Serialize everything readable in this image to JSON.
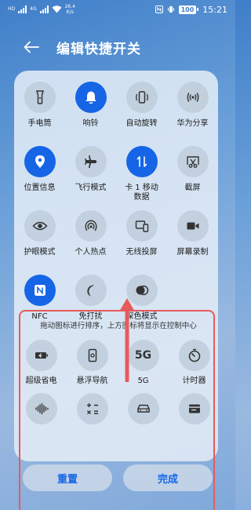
{
  "status_bar": {
    "signal_1_tag": "HD",
    "signal_2_tag": "4G",
    "speed_value": "26.4",
    "speed_unit": "K/s",
    "battery": "100",
    "time": "15:21"
  },
  "header": {
    "title": "编辑快捷开关"
  },
  "active_color": "#1565e6",
  "highlight_color": "#e85a5a",
  "toggles": [
    {
      "label": "手电筒",
      "icon": "flashlight-icon",
      "active": false
    },
    {
      "label": "响铃",
      "icon": "bell-icon",
      "active": true
    },
    {
      "label": "自动旋转",
      "icon": "auto-rotate-icon",
      "active": false
    },
    {
      "label": "华为分享",
      "icon": "share-waves-icon",
      "active": false
    },
    {
      "label": "位置信息",
      "icon": "location-pin-icon",
      "active": true
    },
    {
      "label": "飞行模式",
      "icon": "airplane-icon",
      "active": false
    },
    {
      "label": "卡 1 移动",
      "label2": "数据",
      "icon": "mobile-data-icon",
      "active": true
    },
    {
      "label": "截屏",
      "icon": "screenshot-scissors-icon",
      "active": false
    },
    {
      "label": "护眼模式",
      "icon": "eye-icon",
      "active": false
    },
    {
      "label": "个人热点",
      "icon": "hotspot-icon",
      "active": false
    },
    {
      "label": "无线投屏",
      "icon": "wireless-projection-icon",
      "active": false
    },
    {
      "label": "屏幕录制",
      "icon": "screen-record-icon",
      "active": false
    },
    {
      "label": "NFC",
      "icon": "nfc-icon",
      "active": true
    },
    {
      "label": "免打扰",
      "icon": "moon-icon",
      "active": false
    },
    {
      "label": "深色模式",
      "icon": "dark-mode-icon",
      "active": false
    }
  ],
  "available": {
    "hint": "拖动图标进行排序，上方图标将显示在控制中心",
    "items": [
      {
        "label": "超级省电",
        "icon": "power-saving-icon"
      },
      {
        "label": "悬浮导航",
        "icon": "floating-nav-icon"
      },
      {
        "label": "5G",
        "icon": "5g-icon",
        "glyph": "5G"
      },
      {
        "label": "计时器",
        "icon": "timer-icon"
      },
      {
        "label": "",
        "icon": "sound-wave-icon"
      },
      {
        "label": "",
        "icon": "calculator-icon"
      },
      {
        "label": "",
        "icon": "car-icon"
      },
      {
        "label": "",
        "icon": "wallet-card-icon"
      }
    ]
  },
  "buttons": {
    "reset": "重置",
    "done": "完成"
  }
}
